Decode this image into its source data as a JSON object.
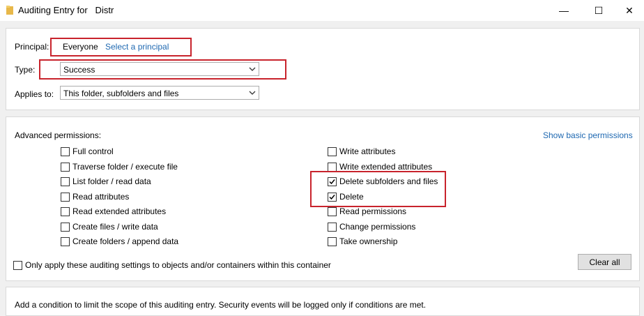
{
  "window": {
    "title": "Auditing Entry for   Distr",
    "minimize_glyph": "—",
    "maximize_glyph": "☐",
    "close_glyph": "✕"
  },
  "principal": {
    "label": "Principal:",
    "value": "Everyone",
    "select_link": "Select a principal"
  },
  "type": {
    "label": "Type:",
    "value": "Success"
  },
  "applies_to": {
    "label": "Applies to:",
    "value": "This folder, subfolders and files"
  },
  "advanced": {
    "heading": "Advanced permissions:",
    "show_basic_link": "Show basic permissions",
    "left_column": [
      {
        "label": "Full control",
        "checked": false
      },
      {
        "label": "Traverse folder / execute file",
        "checked": false
      },
      {
        "label": "List folder / read data",
        "checked": false
      },
      {
        "label": "Read attributes",
        "checked": false
      },
      {
        "label": "Read extended attributes",
        "checked": false
      },
      {
        "label": "Create files / write data",
        "checked": false
      },
      {
        "label": "Create folders / append data",
        "checked": false
      }
    ],
    "right_column": [
      {
        "label": "Write attributes",
        "checked": false
      },
      {
        "label": "Write extended attributes",
        "checked": false
      },
      {
        "label": "Delete subfolders and files",
        "checked": true
      },
      {
        "label": "Delete",
        "checked": true
      },
      {
        "label": "Read permissions",
        "checked": false
      },
      {
        "label": "Change permissions",
        "checked": false
      },
      {
        "label": "Take ownership",
        "checked": false
      }
    ],
    "only_apply": {
      "label": "Only apply these auditing settings to objects and/or containers within this container",
      "checked": false
    },
    "clear_all": "Clear all"
  },
  "condition": {
    "text": "Add a condition to limit the scope of this auditing entry. Security events will be logged only if conditions are met."
  },
  "colors": {
    "accent_link": "#1e68b1",
    "highlight": "#c8232c"
  }
}
